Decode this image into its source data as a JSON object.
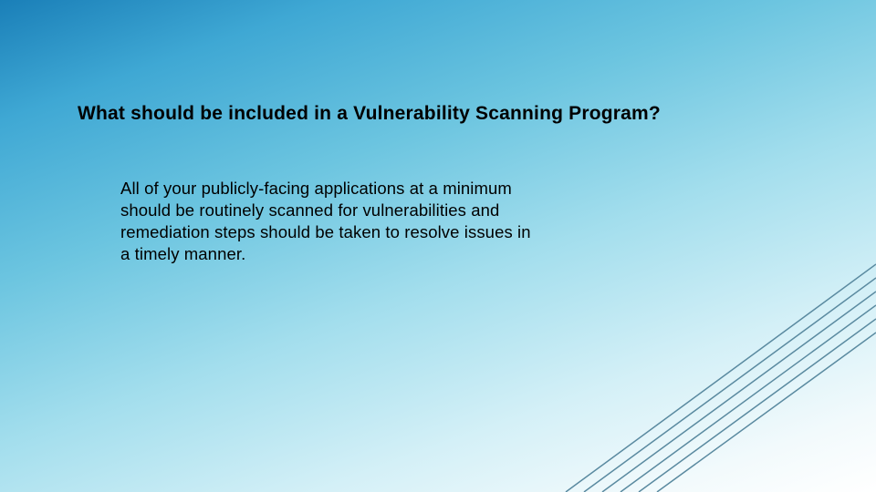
{
  "slide": {
    "title": "What should be included in a Vulnerability Scanning Program?",
    "body": "All of your publicly-facing applications at a minimum should be routinely scanned for vulnerabilities and remediation steps should be taken to resolve issues in a timely manner."
  }
}
